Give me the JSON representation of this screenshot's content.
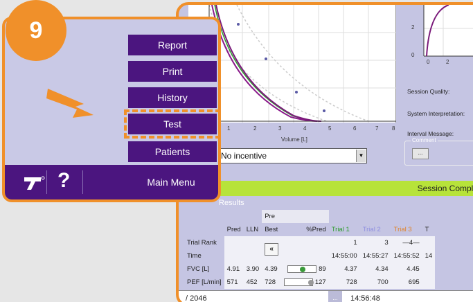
{
  "step_badge": "9",
  "menu": {
    "report": "Report",
    "print": "Print",
    "history": "History",
    "test": "Test",
    "patients": "Patients",
    "main_menu": "Main Menu",
    "help_glyph": "?"
  },
  "icons": {
    "arrow": "arrow-right-icon",
    "logo": "device-logo-icon",
    "help": "help-icon"
  },
  "colors": {
    "accent_orange": "#f0902a",
    "menu_purple": "#4b157f",
    "panel_lavender": "#c9c9e6",
    "session_green": "#b7e33a",
    "trial1": "#2c9c2c",
    "trial2": "#8f8fe0",
    "trial3": "#e0822a"
  },
  "plot": {
    "xlabel": "Volume [L]",
    "x_ticks": [
      "1",
      "2",
      "3",
      "4",
      "5",
      "6",
      "7",
      "8"
    ],
    "small_y_ticks": [
      "2",
      "0"
    ],
    "small_x_ticks": [
      "0",
      "2"
    ]
  },
  "info": {
    "session_quality": "Session Quality:",
    "system_interpretation": "System Interpretation:",
    "interval_message": "Interval Message:",
    "comment_title": "Comment",
    "comment_button": "..."
  },
  "incentive": {
    "selected": "No incentive"
  },
  "session_status": "Session Comple",
  "results": {
    "title": "Results",
    "pre_label": "Pre",
    "headers": [
      "Pred",
      "LLN",
      "Best",
      "%Pred",
      "Trial 1",
      "Trial 2",
      "Trial 3",
      "T"
    ],
    "trial_rank": {
      "label": "Trial Rank",
      "values": [
        "1",
        "3",
        "—4—"
      ]
    },
    "time": {
      "label": "Time",
      "values": [
        "14:55:00",
        "14:55:27",
        "14:55:52",
        "14"
      ]
    },
    "fvc": {
      "label": "FVC [L]",
      "pred": "4.91",
      "lln": "3.90",
      "best": "4.39",
      "pct": "89",
      "trials": [
        "4.37",
        "4.34",
        "4.45"
      ]
    },
    "pef": {
      "label": "PEF [L/min]",
      "pred": "571",
      "lln": "452",
      "best": "728",
      "pct": "127",
      "trials": [
        "728",
        "700",
        "695"
      ]
    }
  },
  "status_bar": {
    "left": "/ 2046",
    "dots": "...",
    "time": "14:56:48"
  }
}
